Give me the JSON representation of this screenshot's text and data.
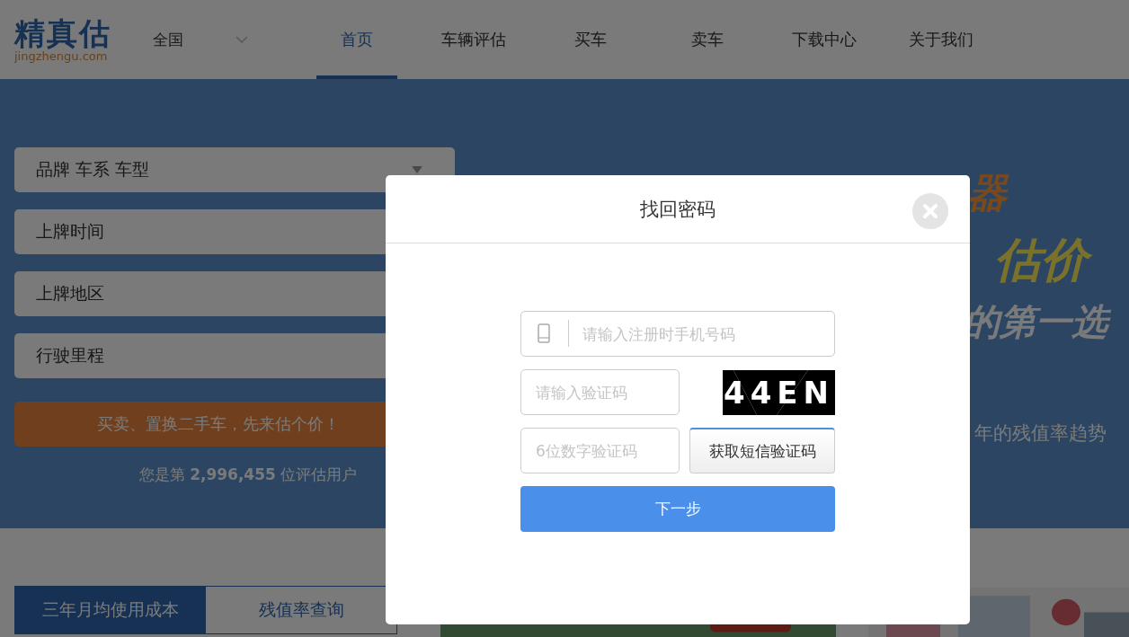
{
  "header": {
    "logo": {
      "name": "精真估",
      "domain": "jingzhengu.com"
    },
    "city_select": {
      "value": "全国"
    },
    "nav": [
      {
        "label": "首页",
        "selected": true
      },
      {
        "label": "车辆评估",
        "selected": false
      },
      {
        "label": "买车",
        "selected": false
      },
      {
        "label": "卖车",
        "selected": false
      },
      {
        "label": "下载中心",
        "selected": false
      },
      {
        "label": "关于我们",
        "selected": false
      }
    ]
  },
  "evaluation_form": {
    "fields": [
      {
        "placeholder": "品牌 车系 车型",
        "kind": "select"
      },
      {
        "placeholder": "上牌时间",
        "kind": "text"
      },
      {
        "placeholder": "上牌地区",
        "kind": "text"
      },
      {
        "placeholder": "行驶里程",
        "kind": "text"
      }
    ],
    "submit": "买卖、置换二手车，先来估个价！",
    "user_count": "您是第 **2,996,455** 位评估用户"
  },
  "banner": {
    "slogans": [
      {
        "text": "器",
        "kind": "orange"
      },
      {
        "text": "估价",
        "kind": "yellow"
      },
      {
        "text": "的第一选",
        "kind": "white"
      }
    ],
    "caption": "年的残值率趋势"
  },
  "lower_tabs": [
    {
      "label": "三年月均使用成本",
      "selected": true
    },
    {
      "label": "残值率查询",
      "selected": false
    }
  ],
  "dialog": {
    "title": "找回密码",
    "phone": {
      "placeholder": "请输入注册时手机号码"
    },
    "captcha": {
      "placeholder": "请输入验证码",
      "image_text": "44EN"
    },
    "sms_code": {
      "placeholder": "6位数字验证码"
    },
    "sms_button": "获取短信验证码",
    "next_button": "下一步"
  }
}
